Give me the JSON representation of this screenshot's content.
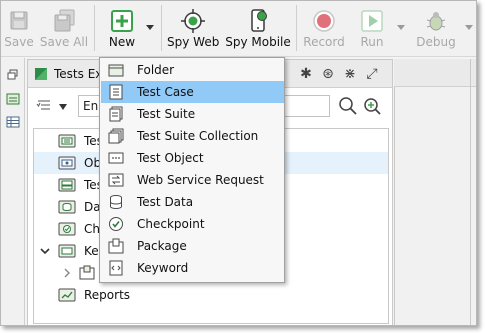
{
  "toolbar": {
    "buttons": [
      {
        "label": "Save",
        "icon": "floppy-icon"
      },
      {
        "label": "Save All",
        "icon": "floppy-multi-icon"
      },
      {
        "label": "New",
        "icon": "plus-icon"
      },
      {
        "label": "Spy Web",
        "icon": "crosshair-icon"
      },
      {
        "label": "Spy Mobile",
        "icon": "mobile-spy-icon"
      },
      {
        "label": "Record",
        "icon": "record-icon"
      },
      {
        "label": "Run",
        "icon": "play-icon"
      },
      {
        "label": "Debug",
        "icon": "bug-icon"
      }
    ]
  },
  "panel": {
    "title": "Tests Exp",
    "search_value": "En"
  },
  "tree": {
    "items": [
      {
        "label": "Tes",
        "icon": "test-cases-folder-icon"
      },
      {
        "label": "Ob",
        "icon": "object-folder-icon"
      },
      {
        "label": "Tes",
        "icon": "test-suites-folder-icon"
      },
      {
        "label": "Da",
        "icon": "data-folder-icon"
      },
      {
        "label": "Ch",
        "icon": "checkpoint-folder-icon"
      },
      {
        "label": "Ke",
        "icon": "keyword-folder-icon"
      },
      {
        "label": "",
        "icon": "package-icon"
      },
      {
        "label": "Reports",
        "icon": "reports-folder-icon"
      }
    ]
  },
  "menu": {
    "highlighted": "Test Case",
    "items": [
      {
        "label": "Folder",
        "icon": "folder-icon"
      },
      {
        "label": "Test Case",
        "icon": "test-case-icon"
      },
      {
        "label": "Test Suite",
        "icon": "test-suite-icon"
      },
      {
        "label": "Test Suite Collection",
        "icon": "test-suite-collection-icon"
      },
      {
        "label": "Test Object",
        "icon": "test-object-icon"
      },
      {
        "label": "Web Service Request",
        "icon": "web-service-icon"
      },
      {
        "label": "Test Data",
        "icon": "database-icon"
      },
      {
        "label": "Checkpoint",
        "icon": "checkpoint-icon"
      },
      {
        "label": "Package",
        "icon": "package-icon"
      },
      {
        "label": "Keyword",
        "icon": "keyword-icon"
      }
    ]
  },
  "colors": {
    "highlight": "#91c9f7",
    "new_green": "#3aa34a",
    "record_red": "#e0707a"
  }
}
